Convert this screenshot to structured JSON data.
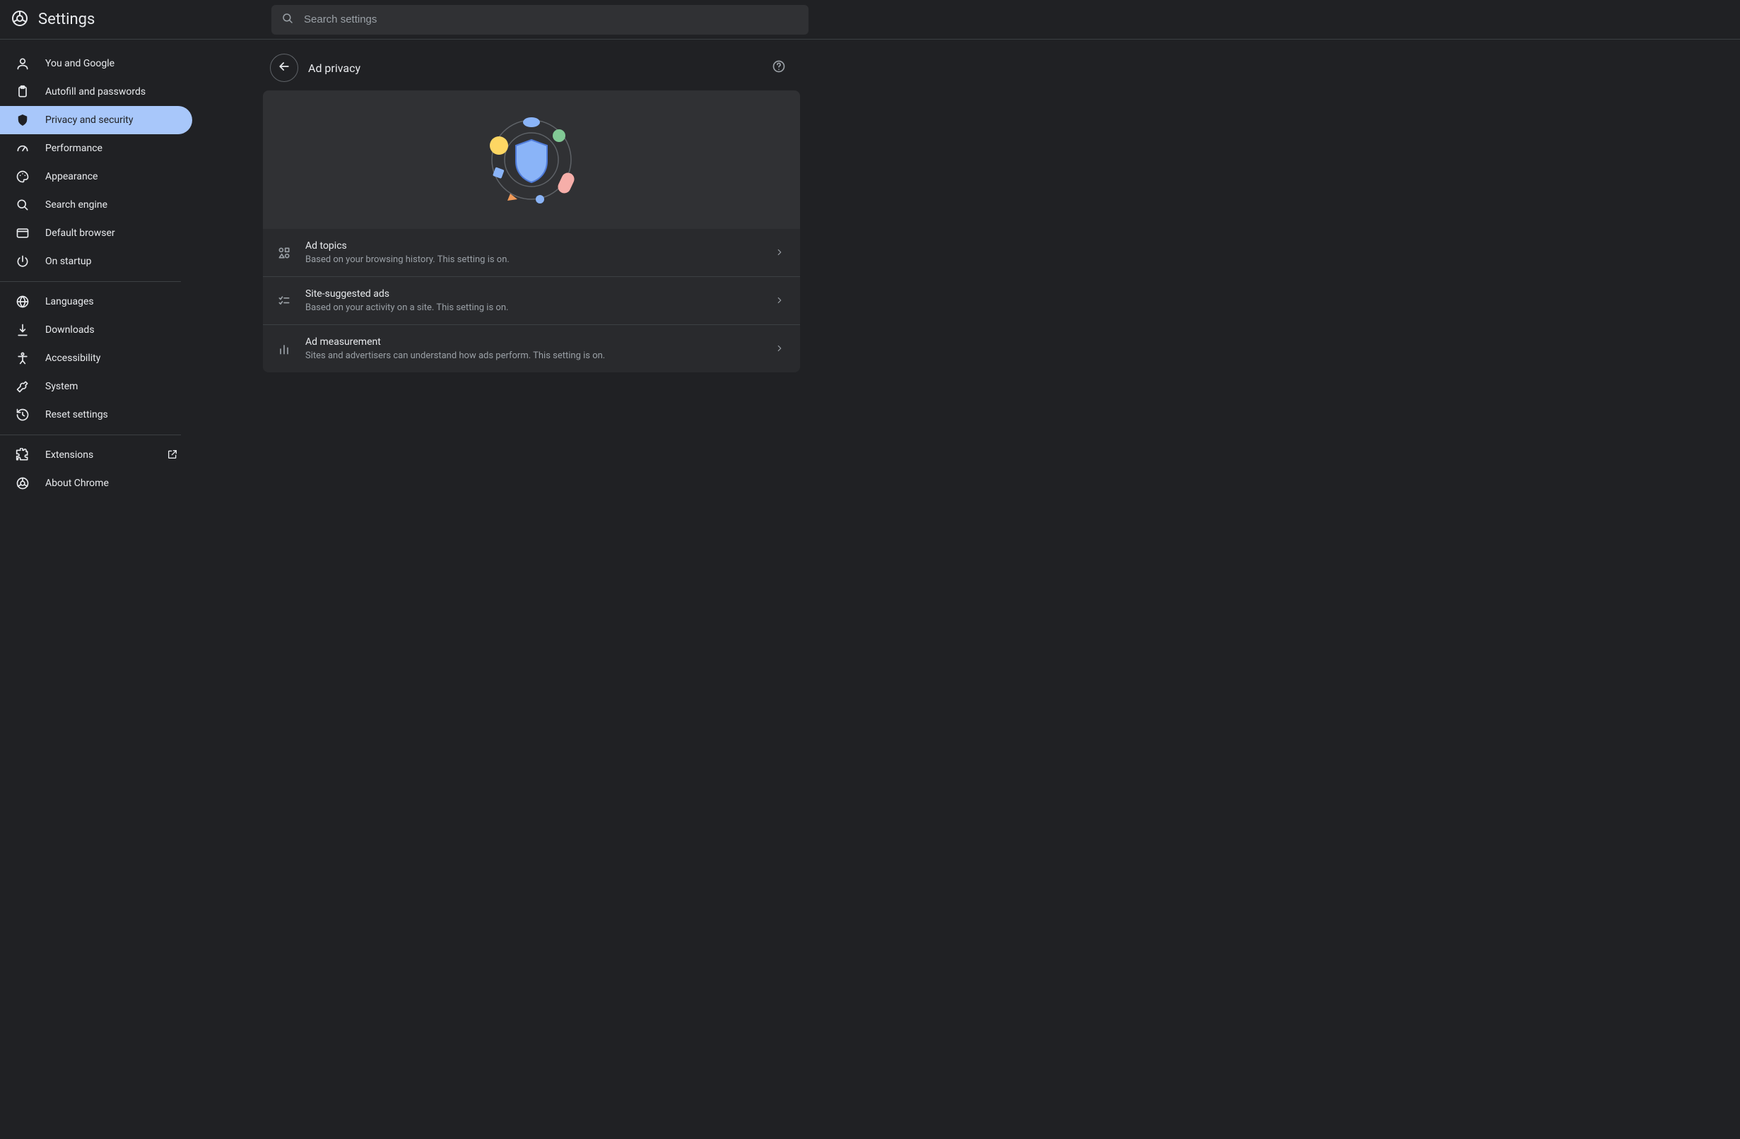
{
  "header": {
    "title": "Settings",
    "search_placeholder": "Search settings"
  },
  "sidebar": {
    "groups": [
      {
        "items": [
          {
            "id": "you-and-google",
            "icon": "person-icon",
            "label": "You and Google"
          },
          {
            "id": "autofill",
            "icon": "clipboard-icon",
            "label": "Autofill and passwords"
          },
          {
            "id": "privacy",
            "icon": "shield-icon",
            "label": "Privacy and security",
            "active": true
          },
          {
            "id": "performance",
            "icon": "speedometer-icon",
            "label": "Performance"
          },
          {
            "id": "appearance",
            "icon": "palette-icon",
            "label": "Appearance"
          },
          {
            "id": "search-engine",
            "icon": "search-icon",
            "label": "Search engine"
          },
          {
            "id": "default-browser",
            "icon": "browser-icon",
            "label": "Default browser"
          },
          {
            "id": "on-startup",
            "icon": "power-icon",
            "label": "On startup"
          }
        ]
      },
      {
        "items": [
          {
            "id": "languages",
            "icon": "globe-icon",
            "label": "Languages"
          },
          {
            "id": "downloads",
            "icon": "download-icon",
            "label": "Downloads"
          },
          {
            "id": "accessibility",
            "icon": "accessibility-icon",
            "label": "Accessibility"
          },
          {
            "id": "system",
            "icon": "wrench-icon",
            "label": "System"
          },
          {
            "id": "reset",
            "icon": "restore-icon",
            "label": "Reset settings"
          }
        ]
      },
      {
        "items": [
          {
            "id": "extensions",
            "icon": "puzzle-icon",
            "label": "Extensions",
            "external": true
          },
          {
            "id": "about",
            "icon": "chrome-icon",
            "label": "About Chrome"
          }
        ]
      }
    ]
  },
  "page": {
    "title": "Ad privacy",
    "rows": [
      {
        "id": "ad-topics",
        "icon": "shapes-icon",
        "title": "Ad topics",
        "sub": "Based on your browsing history. This setting is on."
      },
      {
        "id": "site-suggested",
        "icon": "checklist-icon",
        "title": "Site-suggested ads",
        "sub": "Based on your activity on a site. This setting is on."
      },
      {
        "id": "ad-measurement",
        "icon": "bar-chart-icon",
        "title": "Ad measurement",
        "sub": "Sites and advertisers can understand how ads perform. This setting is on."
      }
    ]
  }
}
